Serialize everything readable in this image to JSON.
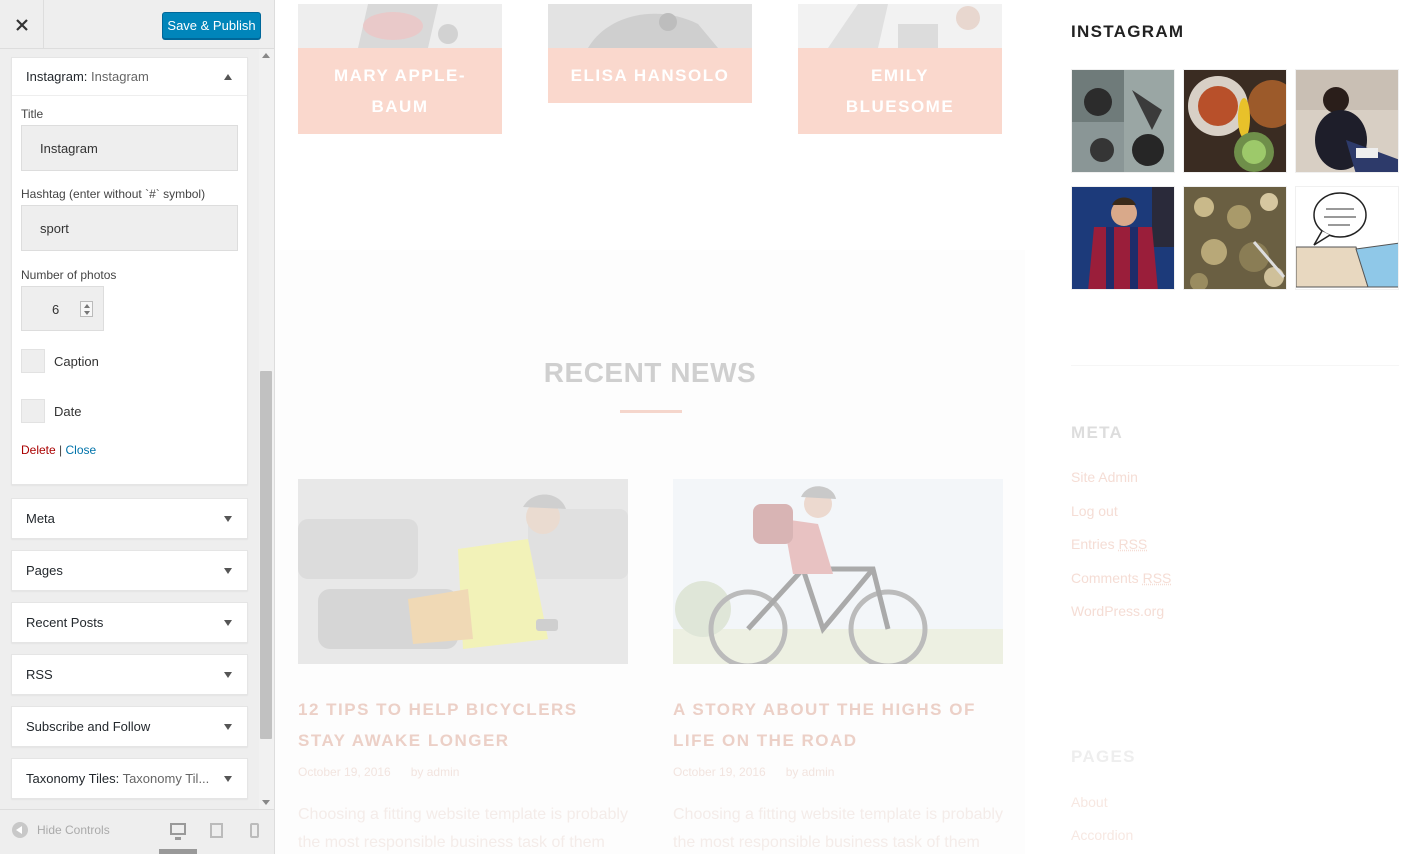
{
  "sidebar": {
    "close_label": "Close",
    "save_publish": "Save & Publish",
    "instagram_widget": {
      "title_prefix": "Instagram:",
      "title_suffix": " Instagram",
      "fields": {
        "title_label": "Title",
        "title_value": "Instagram",
        "hashtag_label": "Hashtag (enter without `#` symbol)",
        "hashtag_value": "sport",
        "photos_label": "Number of photos",
        "photos_value": "6",
        "caption_label": "Caption",
        "date_label": "Date"
      },
      "delete_link": "Delete",
      "separator": "|",
      "close_link": "Close"
    },
    "widgets": [
      {
        "label": "Meta"
      },
      {
        "label": "Pages"
      },
      {
        "label": "Recent Posts"
      },
      {
        "label": "RSS"
      },
      {
        "label": "Subscribe and Follow"
      },
      {
        "label": "Taxonomy Tiles:",
        "hint": " Taxonomy Til..."
      }
    ],
    "hide_controls": "Hide Controls"
  },
  "preview": {
    "team": [
      {
        "name": "MARY APPLE-BAUM"
      },
      {
        "name": "ELISA HANSOLO"
      },
      {
        "name": "EMILY BLUESOME"
      }
    ],
    "news_heading": "RECENT NEWS",
    "posts": [
      {
        "title": "12 TIPS TO HELP BICYCLERS STAY AWAKE LONGER",
        "date": "October 19, 2016",
        "author": "by admin",
        "excerpt": "Choosing a fitting website template is probably the most responsible business task of them"
      },
      {
        "title": "A STORY ABOUT THE HIGHS OF LIFE ON THE ROAD",
        "date": "October 19, 2016",
        "author": "by admin",
        "excerpt": "Choosing a fitting website template is probably the most responsible business task of them"
      }
    ],
    "instagram_title": "INSTAGRAM",
    "meta_heading": "META",
    "meta_links": {
      "site_admin": "Site Admin",
      "log_out": "Log out",
      "entries": "Entries",
      "comments": "Comments",
      "rss": "RSS",
      "wordpress": "WordPress.org"
    },
    "pages_heading": "PAGES",
    "pages_links": [
      "About",
      "Accordion"
    ]
  },
  "colors": {
    "accent": "#0085ba",
    "team_bg": "#fad8cd",
    "delete": "#a00",
    "link": "#0073aa"
  }
}
